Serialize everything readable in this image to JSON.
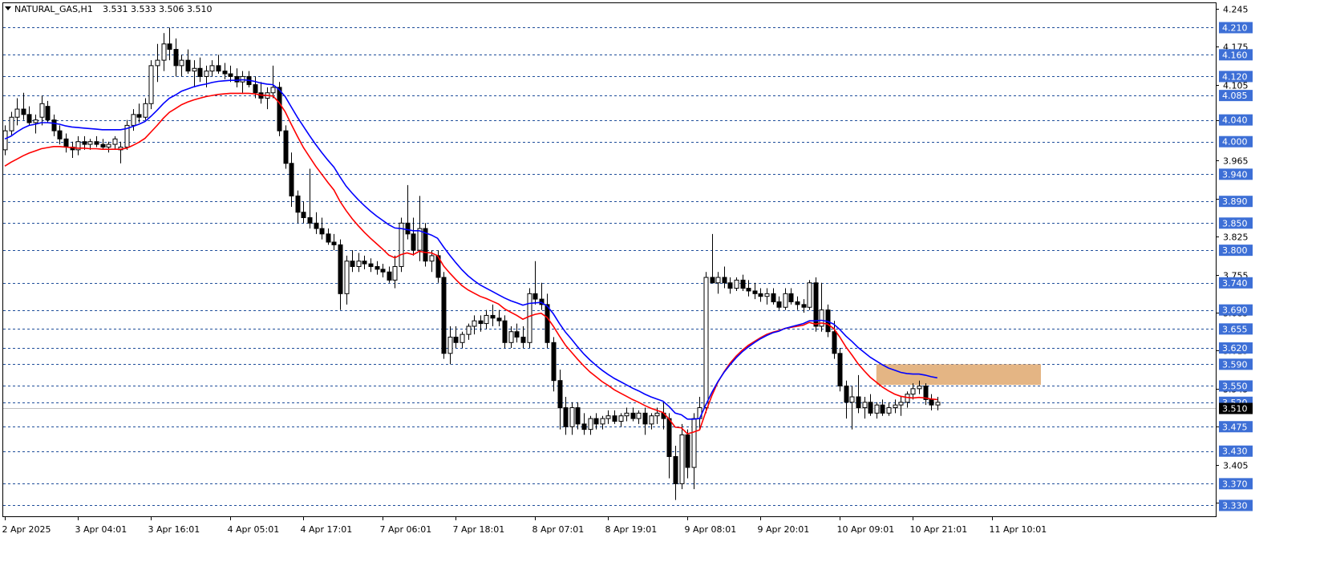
{
  "header": {
    "symbol": "NATURAL_GAS,H1",
    "ohlc": "3.531 3.533 3.506 3.510"
  },
  "colors": {
    "background": "#ffffff",
    "axis": "#000000",
    "grid": "#1f4e9a",
    "level_label_bg": "#3d6fd6",
    "ma_fast": "#0000ff",
    "ma_slow": "#ff0000",
    "zone": "#dfa86f",
    "bid_line": "#c0c0c0"
  },
  "chart_data": {
    "type": "candlestick",
    "ylim": [
      3.31,
      4.255
    ],
    "y_ticks": [
      "4.245",
      "4.175",
      "4.105",
      "4.040",
      "3.965",
      "3.895",
      "3.825",
      "3.755",
      "3.685",
      "3.615",
      "3.545",
      "3.475",
      "3.405",
      "3.335"
    ],
    "levels": [
      "4.210",
      "4.160",
      "4.120",
      "4.085",
      "4.040",
      "4.000",
      "3.940",
      "3.890",
      "3.850",
      "3.800",
      "3.740",
      "3.690",
      "3.655",
      "3.620",
      "3.590",
      "3.550",
      "3.520",
      "3.475",
      "3.430",
      "3.370",
      "3.330"
    ],
    "current_price": 3.51,
    "current_label": "3.510",
    "x_labels": [
      "2 Apr 2025",
      "3 Apr 04:01",
      "3 Apr 16:01",
      "4 Apr 05:01",
      "4 Apr 17:01",
      "7 Apr 06:01",
      "7 Apr 18:01",
      "8 Apr 07:01",
      "8 Apr 19:01",
      "9 Apr 08:01",
      "9 Apr 20:01",
      "10 Apr 09:01",
      "10 Apr 21:01",
      "11 Apr 10:01"
    ],
    "x_label_index": [
      0,
      12,
      24,
      37,
      49,
      62,
      74,
      87,
      99,
      112,
      124,
      137,
      149,
      162
    ],
    "zone": {
      "x_from": 143,
      "x_to": 170,
      "y_from": 3.552,
      "y_to": 3.59
    },
    "ohlc": [
      [
        3.985,
        4.03,
        3.975,
        4.02
      ],
      [
        4.02,
        4.055,
        4.01,
        4.045
      ],
      [
        4.045,
        4.08,
        4.03,
        4.06
      ],
      [
        4.06,
        4.09,
        4.04,
        4.05
      ],
      [
        4.05,
        4.065,
        4.03,
        4.035
      ],
      [
        4.035,
        4.05,
        4.015,
        4.04
      ],
      [
        4.045,
        4.085,
        4.03,
        4.07
      ],
      [
        4.065,
        4.075,
        4.035,
        4.04
      ],
      [
        4.04,
        4.05,
        4.01,
        4.02
      ],
      [
        4.02,
        4.03,
        3.995,
        4.005
      ],
      [
        4.005,
        4.015,
        3.98,
        3.99
      ],
      [
        3.99,
        4.0,
        3.97,
        3.985
      ],
      [
        3.985,
        4.01,
        3.975,
        4.0
      ],
      [
        4.0,
        4.01,
        3.985,
        3.995
      ],
      [
        3.995,
        4.005,
        3.985,
        4.0
      ],
      [
        4.0,
        4.01,
        3.99,
        3.995
      ],
      [
        3.995,
        4.005,
        3.985,
        3.99
      ],
      [
        3.99,
        4.0,
        3.98,
        3.995
      ],
      [
        3.995,
        4.01,
        3.985,
        4.005
      ],
      [
        3.985,
        4.0,
        3.96,
        3.99
      ],
      [
        3.99,
        4.04,
        3.985,
        4.03
      ],
      [
        4.03,
        4.06,
        4.02,
        4.05
      ],
      [
        4.05,
        4.07,
        4.035,
        4.045
      ],
      [
        4.045,
        4.08,
        4.04,
        4.07
      ],
      [
        4.07,
        4.15,
        4.06,
        4.14
      ],
      [
        4.14,
        4.18,
        4.11,
        4.15
      ],
      [
        4.15,
        4.2,
        4.13,
        4.18
      ],
      [
        4.18,
        4.21,
        4.15,
        4.17
      ],
      [
        4.17,
        4.19,
        4.12,
        4.14
      ],
      [
        4.14,
        4.16,
        4.12,
        4.15
      ],
      [
        4.15,
        4.17,
        4.125,
        4.13
      ],
      [
        4.13,
        4.15,
        4.1,
        4.135
      ],
      [
        4.135,
        4.155,
        4.11,
        4.12
      ],
      [
        4.12,
        4.14,
        4.1,
        4.13
      ],
      [
        4.13,
        4.15,
        4.12,
        4.14
      ],
      [
        4.14,
        4.16,
        4.125,
        4.13
      ],
      [
        4.13,
        4.145,
        4.115,
        4.125
      ],
      [
        4.125,
        4.14,
        4.11,
        4.12
      ],
      [
        4.12,
        4.135,
        4.1,
        4.11
      ],
      [
        4.11,
        4.13,
        4.09,
        4.12
      ],
      [
        4.12,
        4.13,
        4.1,
        4.105
      ],
      [
        4.105,
        4.12,
        4.08,
        4.09
      ],
      [
        4.09,
        4.11,
        4.07,
        4.08
      ],
      [
        4.08,
        4.1,
        4.06,
        4.09
      ],
      [
        4.09,
        4.14,
        4.08,
        4.1
      ],
      [
        4.1,
        4.11,
        4.01,
        4.02
      ],
      [
        4.02,
        4.03,
        3.95,
        3.96
      ],
      [
        3.96,
        3.98,
        3.88,
        3.9
      ],
      [
        3.9,
        3.91,
        3.85,
        3.87
      ],
      [
        3.87,
        3.89,
        3.85,
        3.86
      ],
      [
        3.86,
        3.95,
        3.84,
        3.85
      ],
      [
        3.85,
        3.87,
        3.83,
        3.84
      ],
      [
        3.84,
        3.86,
        3.82,
        3.83
      ],
      [
        3.83,
        3.84,
        3.81,
        3.815
      ],
      [
        3.815,
        3.83,
        3.8,
        3.81
      ],
      [
        3.81,
        3.82,
        3.69,
        3.72
      ],
      [
        3.72,
        3.79,
        3.7,
        3.78
      ],
      [
        3.78,
        3.8,
        3.76,
        3.77
      ],
      [
        3.77,
        3.795,
        3.76,
        3.78
      ],
      [
        3.78,
        3.79,
        3.765,
        3.775
      ],
      [
        3.775,
        3.785,
        3.76,
        3.77
      ],
      [
        3.77,
        3.78,
        3.755,
        3.765
      ],
      [
        3.765,
        3.775,
        3.75,
        3.76
      ],
      [
        3.76,
        3.77,
        3.74,
        3.745
      ],
      [
        3.745,
        3.79,
        3.73,
        3.77
      ],
      [
        3.77,
        3.86,
        3.76,
        3.85
      ],
      [
        3.85,
        3.92,
        3.82,
        3.83
      ],
      [
        3.83,
        3.86,
        3.79,
        3.8
      ],
      [
        3.8,
        3.9,
        3.78,
        3.84
      ],
      [
        3.84,
        3.85,
        3.77,
        3.78
      ],
      [
        3.78,
        3.8,
        3.76,
        3.79
      ],
      [
        3.79,
        3.8,
        3.74,
        3.75
      ],
      [
        3.75,
        3.76,
        3.6,
        3.61
      ],
      [
        3.61,
        3.66,
        3.59,
        3.64
      ],
      [
        3.64,
        3.66,
        3.62,
        3.63
      ],
      [
        3.63,
        3.65,
        3.62,
        3.645
      ],
      [
        3.645,
        3.665,
        3.635,
        3.66
      ],
      [
        3.66,
        3.68,
        3.645,
        3.67
      ],
      [
        3.67,
        3.68,
        3.65,
        3.665
      ],
      [
        3.665,
        3.69,
        3.655,
        3.68
      ],
      [
        3.68,
        3.7,
        3.66,
        3.675
      ],
      [
        3.675,
        3.69,
        3.66,
        3.67
      ],
      [
        3.67,
        3.68,
        3.62,
        3.63
      ],
      [
        3.63,
        3.66,
        3.62,
        3.65
      ],
      [
        3.65,
        3.665,
        3.63,
        3.64
      ],
      [
        3.64,
        3.66,
        3.62,
        3.63
      ],
      [
        3.63,
        3.73,
        3.62,
        3.72
      ],
      [
        3.72,
        3.78,
        3.7,
        3.71
      ],
      [
        3.71,
        3.74,
        3.69,
        3.7
      ],
      [
        3.7,
        3.72,
        3.62,
        3.63
      ],
      [
        3.63,
        3.64,
        3.54,
        3.56
      ],
      [
        3.56,
        3.58,
        3.47,
        3.51
      ],
      [
        3.51,
        3.53,
        3.46,
        3.475
      ],
      [
        3.475,
        3.52,
        3.46,
        3.51
      ],
      [
        3.51,
        3.52,
        3.47,
        3.48
      ],
      [
        3.48,
        3.5,
        3.46,
        3.47
      ],
      [
        3.47,
        3.495,
        3.46,
        3.49
      ],
      [
        3.49,
        3.5,
        3.47,
        3.48
      ],
      [
        3.48,
        3.495,
        3.47,
        3.49
      ],
      [
        3.49,
        3.505,
        3.48,
        3.495
      ],
      [
        3.495,
        3.505,
        3.48,
        3.485
      ],
      [
        3.485,
        3.5,
        3.475,
        3.495
      ],
      [
        3.495,
        3.51,
        3.485,
        3.5
      ],
      [
        3.5,
        3.51,
        3.485,
        3.49
      ],
      [
        3.49,
        3.505,
        3.48,
        3.5
      ],
      [
        3.5,
        3.51,
        3.46,
        3.48
      ],
      [
        3.48,
        3.5,
        3.47,
        3.495
      ],
      [
        3.495,
        3.51,
        3.48,
        3.5
      ],
      [
        3.5,
        3.52,
        3.47,
        3.49
      ],
      [
        3.49,
        3.5,
        3.38,
        3.42
      ],
      [
        3.42,
        3.44,
        3.34,
        3.37
      ],
      [
        3.37,
        3.48,
        3.36,
        3.46
      ],
      [
        3.46,
        3.47,
        3.38,
        3.4
      ],
      [
        3.4,
        3.5,
        3.36,
        3.49
      ],
      [
        3.49,
        3.53,
        3.47,
        3.51
      ],
      [
        3.51,
        3.76,
        3.5,
        3.75
      ],
      [
        3.75,
        3.83,
        3.74,
        3.74
      ],
      [
        3.74,
        3.76,
        3.72,
        3.75
      ],
      [
        3.75,
        3.77,
        3.73,
        3.74
      ],
      [
        3.74,
        3.75,
        3.72,
        3.73
      ],
      [
        3.73,
        3.75,
        3.725,
        3.745
      ],
      [
        3.745,
        3.755,
        3.725,
        3.73
      ],
      [
        3.73,
        3.745,
        3.715,
        3.725
      ],
      [
        3.725,
        3.74,
        3.71,
        3.72
      ],
      [
        3.72,
        3.73,
        3.705,
        3.715
      ],
      [
        3.715,
        3.73,
        3.7,
        3.72
      ],
      [
        3.72,
        3.73,
        3.7,
        3.705
      ],
      [
        3.705,
        3.715,
        3.69,
        3.695
      ],
      [
        3.695,
        3.73,
        3.69,
        3.72
      ],
      [
        3.72,
        3.73,
        3.7,
        3.705
      ],
      [
        3.705,
        3.715,
        3.69,
        3.7
      ],
      [
        3.7,
        3.71,
        3.685,
        3.695
      ],
      [
        3.695,
        3.745,
        3.69,
        3.74
      ],
      [
        3.74,
        3.75,
        3.65,
        3.66
      ],
      [
        3.66,
        3.74,
        3.65,
        3.69
      ],
      [
        3.69,
        3.7,
        3.64,
        3.65
      ],
      [
        3.65,
        3.67,
        3.6,
        3.61
      ],
      [
        3.61,
        3.62,
        3.54,
        3.55
      ],
      [
        3.55,
        3.56,
        3.49,
        3.52
      ],
      [
        3.52,
        3.55,
        3.47,
        3.53
      ],
      [
        3.53,
        3.57,
        3.5,
        3.51
      ],
      [
        3.51,
        3.53,
        3.49,
        3.52
      ],
      [
        3.52,
        3.535,
        3.495,
        3.5
      ],
      [
        3.5,
        3.52,
        3.49,
        3.515
      ],
      [
        3.515,
        3.525,
        3.495,
        3.5
      ],
      [
        3.5,
        3.52,
        3.495,
        3.51
      ],
      [
        3.51,
        3.525,
        3.5,
        3.515
      ],
      [
        3.515,
        3.53,
        3.495,
        3.52
      ],
      [
        3.52,
        3.54,
        3.51,
        3.535
      ],
      [
        3.535,
        3.555,
        3.525,
        3.545
      ],
      [
        3.545,
        3.56,
        3.535,
        3.55
      ],
      [
        3.55,
        3.555,
        3.515,
        3.525
      ],
      [
        3.525,
        3.535,
        3.505,
        3.515
      ],
      [
        3.515,
        3.53,
        3.505,
        3.52
      ]
    ],
    "ma_fast": [
      4.005,
      4.01,
      4.018,
      4.025,
      4.03,
      4.032,
      4.035,
      4.035,
      4.034,
      4.032,
      4.029,
      4.027,
      4.026,
      4.025,
      4.024,
      4.023,
      4.022,
      4.022,
      4.022,
      4.022,
      4.024,
      4.028,
      4.032,
      4.037,
      4.047,
      4.058,
      4.07,
      4.08,
      4.086,
      4.093,
      4.097,
      4.101,
      4.104,
      4.106,
      4.109,
      4.111,
      4.112,
      4.113,
      4.113,
      4.114,
      4.113,
      4.111,
      4.108,
      4.106,
      4.105,
      4.096,
      4.083,
      4.064,
      4.045,
      4.028,
      4.011,
      3.995,
      3.98,
      3.966,
      3.953,
      3.935,
      3.918,
      3.905,
      3.893,
      3.882,
      3.872,
      3.863,
      3.855,
      3.847,
      3.841,
      3.84,
      3.838,
      3.836,
      3.836,
      3.832,
      3.828,
      3.822,
      3.806,
      3.791,
      3.777,
      3.764,
      3.753,
      3.744,
      3.736,
      3.73,
      3.724,
      3.718,
      3.712,
      3.707,
      3.703,
      3.699,
      3.702,
      3.703,
      3.704,
      3.697,
      3.683,
      3.665,
      3.649,
      3.636,
      3.622,
      3.609,
      3.598,
      3.588,
      3.579,
      3.571,
      3.564,
      3.558,
      3.552,
      3.546,
      3.541,
      3.535,
      3.53,
      3.526,
      3.522,
      3.512,
      3.5,
      3.497,
      3.489,
      3.489,
      3.49,
      3.515,
      3.538,
      3.558,
      3.575,
      3.589,
      3.602,
      3.613,
      3.622,
      3.63,
      3.637,
      3.643,
      3.648,
      3.651,
      3.656,
      3.659,
      3.662,
      3.665,
      3.67,
      3.67,
      3.671,
      3.669,
      3.664,
      3.654,
      3.642,
      3.632,
      3.621,
      3.612,
      3.603,
      3.596,
      3.589,
      3.583,
      3.579,
      3.575,
      3.573,
      3.572,
      3.572,
      3.57,
      3.567,
      3.565
    ],
    "ma_slow": [
      3.955,
      3.962,
      3.968,
      3.974,
      3.979,
      3.983,
      3.987,
      3.989,
      3.991,
      3.991,
      3.99,
      3.989,
      3.988,
      3.988,
      3.987,
      3.987,
      3.986,
      3.986,
      3.986,
      3.986,
      3.988,
      3.993,
      3.999,
      4.006,
      4.018,
      4.03,
      4.043,
      4.054,
      4.061,
      4.068,
      4.073,
      4.077,
      4.08,
      4.083,
      4.085,
      4.087,
      4.088,
      4.089,
      4.089,
      4.089,
      4.089,
      4.088,
      4.086,
      4.085,
      4.084,
      4.072,
      4.055,
      4.032,
      4.01,
      3.989,
      3.972,
      3.955,
      3.94,
      3.925,
      3.911,
      3.89,
      3.873,
      3.858,
      3.845,
      3.833,
      3.822,
      3.812,
      3.802,
      3.791,
      3.786,
      3.792,
      3.795,
      3.792,
      3.798,
      3.796,
      3.795,
      3.79,
      3.771,
      3.758,
      3.746,
      3.735,
      3.727,
      3.721,
      3.715,
      3.711,
      3.706,
      3.701,
      3.692,
      3.686,
      3.68,
      3.673,
      3.678,
      3.682,
      3.684,
      3.676,
      3.66,
      3.642,
      3.625,
      3.612,
      3.599,
      3.587,
      3.576,
      3.567,
      3.558,
      3.551,
      3.543,
      3.537,
      3.531,
      3.525,
      3.52,
      3.514,
      3.509,
      3.505,
      3.501,
      3.489,
      3.474,
      3.473,
      3.462,
      3.465,
      3.469,
      3.502,
      3.532,
      3.557,
      3.576,
      3.592,
      3.605,
      3.616,
      3.625,
      3.632,
      3.639,
      3.645,
      3.649,
      3.652,
      3.656,
      3.658,
      3.66,
      3.662,
      3.667,
      3.664,
      3.666,
      3.664,
      3.656,
      3.64,
      3.622,
      3.607,
      3.591,
      3.578,
      3.566,
      3.557,
      3.548,
      3.541,
      3.535,
      3.531,
      3.529,
      3.528,
      3.529,
      3.528,
      3.526,
      3.525
    ]
  }
}
